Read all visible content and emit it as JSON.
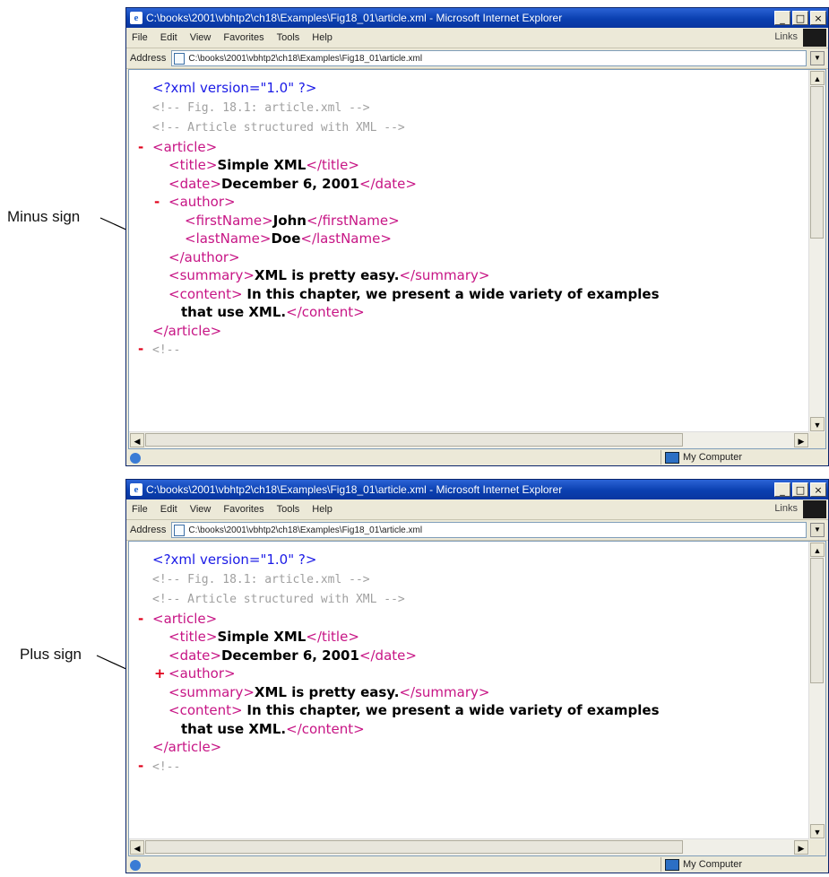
{
  "callouts": {
    "top": "Minus sign",
    "bottom": "Plus sign"
  },
  "window": {
    "title": "C:\\books\\2001\\vbhtp2\\ch18\\Examples\\Fig18_01\\article.xml - Microsoft Internet Explorer",
    "menu": [
      "File",
      "Edit",
      "View",
      "Favorites",
      "Tools",
      "Help"
    ],
    "links_label": "Links",
    "address_label": "Address",
    "address_value": "C:\\books\\2001\\vbhtp2\\ch18\\Examples\\Fig18_01\\article.xml",
    "status_zone": "My Computer"
  },
  "xml": {
    "declaration": "<?xml version=\"1.0\" ?>",
    "comment1": "<!-- Fig. 18.1: article.xml      -->",
    "comment2": "<!-- Article structured with XML  -->",
    "article_open": "<article>",
    "article_close": "</article>",
    "title_open": "<title>",
    "title_text": "Simple XML",
    "title_close": "</title>",
    "date_open": "<date>",
    "date_text": "December 6, 2001",
    "date_close": "</date>",
    "author_open": "<author>",
    "author_close": "</author>",
    "first_open": "<firstName>",
    "first_text": "John",
    "first_close": "</firstName>",
    "last_open": "<lastName>",
    "last_text": "Doe",
    "last_close": "</lastName>",
    "summary_open": "<summary>",
    "summary_text": "XML is pretty easy.",
    "summary_close": "</summary>",
    "content_open": "<content>",
    "content_text1": "In this chapter, we present a wide variety of examples",
    "content_text2": "that use XML.",
    "content_close": "</content>",
    "trailing": "<!--",
    "minus": "-",
    "plus": "+"
  }
}
